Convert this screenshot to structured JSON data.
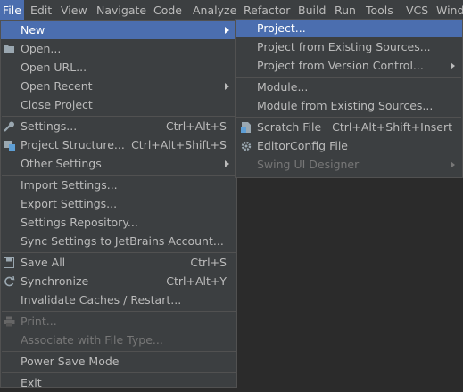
{
  "menubar": [
    "File",
    "Edit",
    "View",
    "Navigate",
    "Code",
    "Analyze",
    "Refactor",
    "Build",
    "Run",
    "Tools",
    "VCS",
    "Wind"
  ],
  "file_menu": {
    "new": "New",
    "open": "Open...",
    "open_url": "Open URL...",
    "open_recent": "Open Recent",
    "close_project": "Close Project",
    "settings": "Settings...",
    "settings_shortcut": "Ctrl+Alt+S",
    "project_structure": "Project Structure...",
    "project_structure_shortcut": "Ctrl+Alt+Shift+S",
    "other_settings": "Other Settings",
    "import_settings": "Import Settings...",
    "export_settings": "Export Settings...",
    "settings_repository": "Settings Repository...",
    "sync_settings": "Sync Settings to JetBrains Account...",
    "save_all": "Save All",
    "save_all_shortcut": "Ctrl+S",
    "synchronize": "Synchronize",
    "synchronize_shortcut": "Ctrl+Alt+Y",
    "invalidate_caches": "Invalidate Caches / Restart...",
    "print": "Print...",
    "associate_file_type": "Associate with File Type...",
    "power_save_mode": "Power Save Mode",
    "exit": "Exit"
  },
  "new_submenu": {
    "project": "Project...",
    "project_existing": "Project from Existing Sources...",
    "project_vcs": "Project from Version Control...",
    "module": "Module...",
    "module_existing": "Module from Existing Sources...",
    "scratch_file": "Scratch File",
    "scratch_file_shortcut": "Ctrl+Alt+Shift+Insert",
    "editorconfig_file": "EditorConfig File",
    "swing_ui_designer": "Swing UI Designer"
  },
  "colors": {
    "menu_bg": "#3c3f41",
    "selection": "#4b6eaf",
    "text": "#bbbbbb",
    "disabled_text": "#777777",
    "separator": "#515151",
    "editor_bg": "#2b2b2b"
  }
}
